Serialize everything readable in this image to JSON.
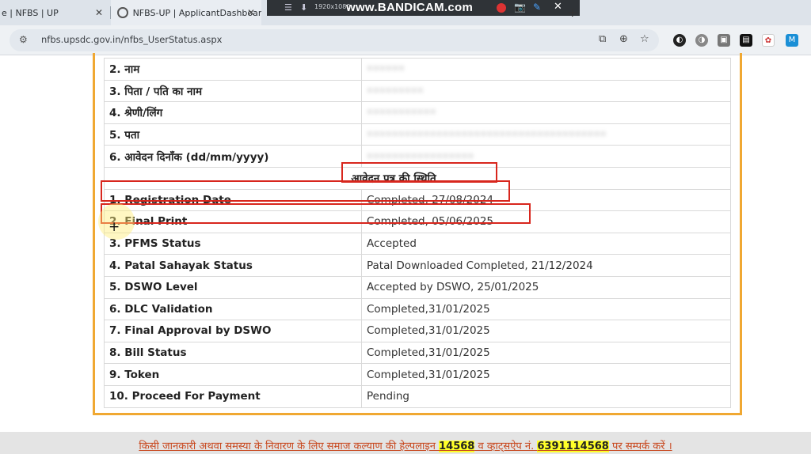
{
  "browser": {
    "tabs": [
      {
        "title": "e | NFBS | UP"
      },
      {
        "title": "NFBS-UP | ApplicantDashboard"
      },
      {
        "title": ""
      }
    ],
    "url": "nfbs.upsdc.gov.in/nfbs_UserStatus.aspx",
    "recorder": {
      "resolution": "1920x1080",
      "brand": "www.BANDICAM.com"
    }
  },
  "applicant_info": [
    {
      "label": "2. नाम",
      "value": "••••••"
    },
    {
      "label": "3. पिता / पति का नाम",
      "value": "•••••••••"
    },
    {
      "label": "4. श्रेणी/लिंग",
      "value": "•••••••••••"
    },
    {
      "label": "5. पता",
      "value": "••••••••••••••••••••••••••••••••••••••"
    },
    {
      "label": "6. आवेदन दिनाँक (dd/mm/yyyy)",
      "value": "•••••••••••••••••"
    }
  ],
  "status_section": {
    "heading": "आवेदन पत्र की स्थिति",
    "rows": [
      {
        "label": "1. Registration Date",
        "value": "Completed, 27/08/2024"
      },
      {
        "label": "2. Final Print",
        "value": "Completed, 05/06/2025"
      },
      {
        "label": "3. PFMS Status",
        "value": "Accepted"
      },
      {
        "label": "4. Patal Sahayak Status",
        "value": "Patal Downloaded Completed, 21/12/2024"
      },
      {
        "label": "5. DSWO Level",
        "value": "Accepted by DSWO, 25/01/2025"
      },
      {
        "label": "6. DLC Validation",
        "value": "Completed,31/01/2025"
      },
      {
        "label": "7. Final Approval by DSWO",
        "value": "Completed,31/01/2025"
      },
      {
        "label": "8. Bill Status",
        "value": "Completed,31/01/2025"
      },
      {
        "label": "9. Token",
        "value": "Completed,31/01/2025"
      },
      {
        "label": "10. Proceed For Payment",
        "value": "Pending"
      }
    ]
  },
  "footer": {
    "prefix": "किसी जानकारी अथवा समस्या के निवारण के लिए समाज कल्याण की हेल्पलाइन ",
    "helpline": "14568",
    "middle": " व व्हाट्सऐप नं. ",
    "whatsapp": "6391114568",
    "suffix": " पर सम्पर्क करें ।"
  },
  "colors": {
    "frame": "#f0a832",
    "annotation": "#d8261d",
    "highlight": "#ffff28",
    "footer_text": "#c8471d"
  }
}
